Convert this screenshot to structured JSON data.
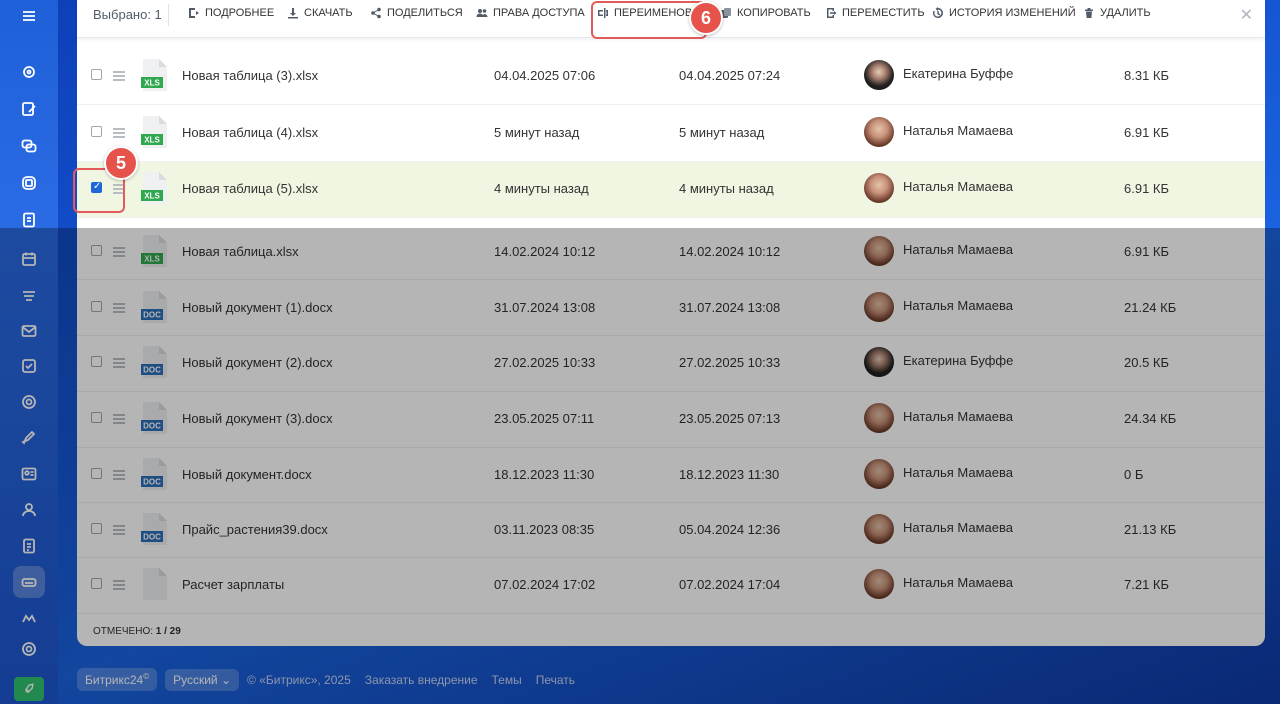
{
  "toolbar": {
    "selected": "Выбрано: 1",
    "buttons": [
      {
        "label": "Подробнее",
        "icon": "details-icon"
      },
      {
        "label": "Скачать",
        "icon": "download-icon"
      },
      {
        "label": "Поделиться",
        "icon": "share-icon"
      },
      {
        "label": "Права доступа",
        "icon": "users-icon"
      },
      {
        "label": "Переименоват",
        "icon": "rename-icon"
      },
      {
        "label": "Копировать",
        "icon": "copy-icon"
      },
      {
        "label": "Переместить",
        "icon": "move-icon"
      },
      {
        "label": "История изменений",
        "icon": "history-icon"
      },
      {
        "label": "Удалить",
        "icon": "trash-icon"
      }
    ],
    "close": "✕"
  },
  "rows": [
    {
      "name": "Новая таблица (3).xlsx",
      "type": "XLS",
      "created": "04.04.2025 07:06",
      "modified": "04.04.2025 07:24",
      "owner": "Екатерина Буффе",
      "size": "8.31 КБ",
      "checked": false
    },
    {
      "name": "Новая таблица (4).xlsx",
      "type": "XLS",
      "created": "5 минут назад",
      "modified": "5 минут назад",
      "owner": "Наталья Мамаева",
      "size": "6.91 КБ",
      "checked": false
    },
    {
      "name": "Новая таблица (5).xlsx",
      "type": "XLS",
      "created": "4 минуты назад",
      "modified": "4 минуты назад",
      "owner": "Наталья Мамаева",
      "size": "6.91 КБ",
      "checked": true
    },
    {
      "name": "Новая таблица.xlsx",
      "type": "XLS",
      "created": "14.02.2024 10:12",
      "modified": "14.02.2024 10:12",
      "owner": "Наталья Мамаева",
      "size": "6.91 КБ",
      "checked": false
    },
    {
      "name": "Новый документ (1).docx",
      "type": "DOC",
      "created": "31.07.2024 13:08",
      "modified": "31.07.2024 13:08",
      "owner": "Наталья Мамаева",
      "size": "21.24 КБ",
      "checked": false
    },
    {
      "name": "Новый документ (2).docx",
      "type": "DOC",
      "created": "27.02.2025 10:33",
      "modified": "27.02.2025 10:33",
      "owner": "Екатерина Буффе",
      "size": "20.5 КБ",
      "checked": false
    },
    {
      "name": "Новый документ (3).docx",
      "type": "DOC",
      "created": "23.05.2025 07:11",
      "modified": "23.05.2025 07:13",
      "owner": "Наталья Мамаева",
      "size": "24.34 КБ",
      "checked": false
    },
    {
      "name": "Новый документ.docx",
      "type": "DOC",
      "created": "18.12.2023 11:30",
      "modified": "18.12.2023 11:30",
      "owner": "Наталья Мамаева",
      "size": "0 Б",
      "checked": false
    },
    {
      "name": "Прайс_растения39.docx",
      "type": "DOC",
      "created": "03.11.2023 08:35",
      "modified": "05.04.2024 12:36",
      "owner": "Наталья Мамаева",
      "size": "21.13 КБ",
      "checked": false
    },
    {
      "name": "Расчет зарплаты",
      "type": "",
      "created": "07.02.2024 17:02",
      "modified": "07.02.2024 17:04",
      "owner": "Наталья Мамаева",
      "size": "7.21 КБ",
      "checked": false
    }
  ],
  "footer": {
    "marked_label": "ОТМЕЧЕНО:",
    "marked_value": "1 / 29"
  },
  "bottom": {
    "brand": "Битрикс24",
    "brand_mark": "©",
    "language": "Русский",
    "copyright": "© «Битрикс», 2025",
    "links": [
      "Заказать внедрение",
      "Темы",
      "Печать"
    ]
  },
  "callouts": {
    "step_checkbox": "5",
    "step_rename": "6"
  },
  "colors": {
    "accent": "#2066d8",
    "callout": "#e5534b",
    "xls": "#2fa84f",
    "doc": "#2d6fba",
    "selected_row": "#f1f6e3"
  }
}
